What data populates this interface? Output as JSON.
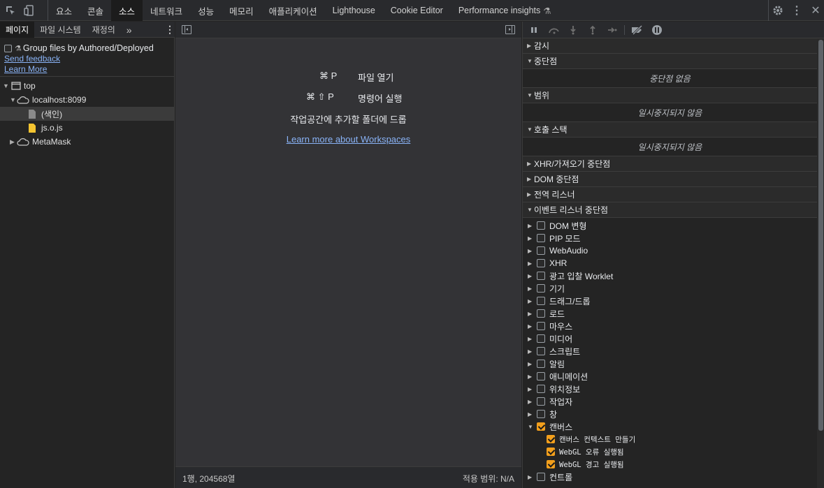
{
  "toolbar": {
    "tabs": [
      "요소",
      "콘솔",
      "소스",
      "네트워크",
      "성능",
      "메모리",
      "애플리케이션",
      "Lighthouse",
      "Cookie Editor",
      "Performance insights"
    ],
    "active_tab": "소스"
  },
  "navigator": {
    "tabs": [
      "페이지",
      "파일 시스템",
      "재정의"
    ],
    "more": "»",
    "group_label": "Group files by Authored/Deployed",
    "send_feedback": "Send feedback",
    "learn_more": "Learn More",
    "tree": [
      {
        "label": "top"
      },
      {
        "label": "localhost:8099"
      },
      {
        "label": "(색인)"
      },
      {
        "label": "js.o.js"
      },
      {
        "label": "MetaMask"
      }
    ]
  },
  "editor": {
    "shortcut1_keys": "⌘ P",
    "shortcut1_label": "파일 열기",
    "shortcut2_keys": "⌘ ⇧ P",
    "shortcut2_label": "명령어 실행",
    "drop_hint": "작업공간에 추가할 폴더에 드롭",
    "workspaces_link": "Learn more about Workspaces",
    "status_position": "1행, 204568열",
    "status_coverage": "적용 범위: N/A"
  },
  "debugger": {
    "watch": "감시",
    "breakpoints": "중단점",
    "no_breakpoints": "중단점 없음",
    "scope": "범위",
    "not_paused": "일시중지되지 않음",
    "call_stack": "호출 스택",
    "not_paused2": "일시중지되지 않음",
    "xhr": "XHR/가져오기 중단점",
    "dom": "DOM 중단점",
    "global": "전역 리스너",
    "event_listener": "이벤트 리스너 중단점",
    "events": [
      "DOM 변형",
      "PIP 모드",
      "WebAudio",
      "XHR",
      "광고 입찰 Worklet",
      "기기",
      "드래그/드롭",
      "로드",
      "마우스",
      "미디어",
      "스크립트",
      "알림",
      "애니메이션",
      "위치정보",
      "작업자",
      "창"
    ],
    "canvas": "캔버스",
    "canvas_items": [
      "캔버스 컨텍스트 만들기",
      "WebGL 오류 실행됨",
      "WebGL 경고 실행됨"
    ],
    "control": "컨트롤"
  }
}
